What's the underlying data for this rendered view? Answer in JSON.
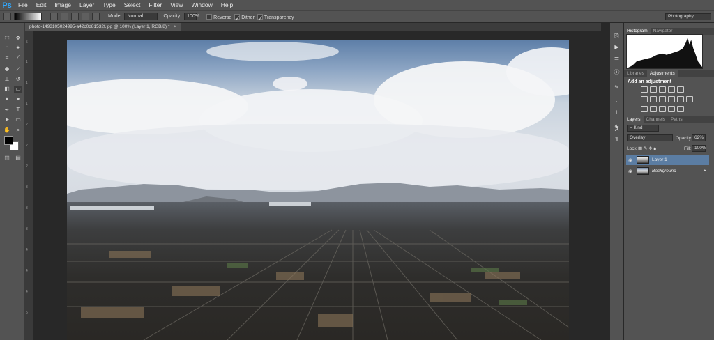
{
  "app": {
    "logo": "Ps"
  },
  "menu": [
    "File",
    "Edit",
    "Image",
    "Layer",
    "Type",
    "Select",
    "Filter",
    "View",
    "Window",
    "Help"
  ],
  "options_bar": {
    "mode_label": "Mode:",
    "mode_value": "Normal",
    "opacity_label": "Opacity:",
    "opacity_value": "100%",
    "reverse_label": "Reverse",
    "dither_label": "Dither",
    "transparency_label": "Transparency",
    "workspace": "Photography"
  },
  "document_tab": {
    "title": "photo-1493105024995-a42c0d81532f.jpg @ 100% (Layer 1, RGB/8) *",
    "close": "×"
  },
  "ruler_ticks": [
    "5",
    "1",
    "1",
    "1",
    "2",
    "2",
    "2",
    "3",
    "3",
    "3",
    "4",
    "4",
    "4",
    "5"
  ],
  "panels": {
    "top_tabs": [
      "Histogram",
      "Navigator"
    ],
    "mid_tabs": [
      "Libraries",
      "Adjustments"
    ],
    "adjustments_title": "Add an adjustment",
    "layer_tabs": [
      "Layers",
      "Channels",
      "Paths"
    ],
    "kind": "Kind",
    "blend_mode": "Overlay",
    "opacity_label": "Opacity:",
    "opacity_value": "62%",
    "lock_label": "Lock:",
    "fill_label": "Fill:",
    "fill_value": "100%",
    "layers": [
      {
        "name": "Layer 1",
        "selected": true
      },
      {
        "name": "Background",
        "selected": false
      }
    ]
  },
  "colors": {
    "accent": "#31a8ff",
    "selected_layer": "#5b7da3",
    "chrome": "#535353"
  }
}
